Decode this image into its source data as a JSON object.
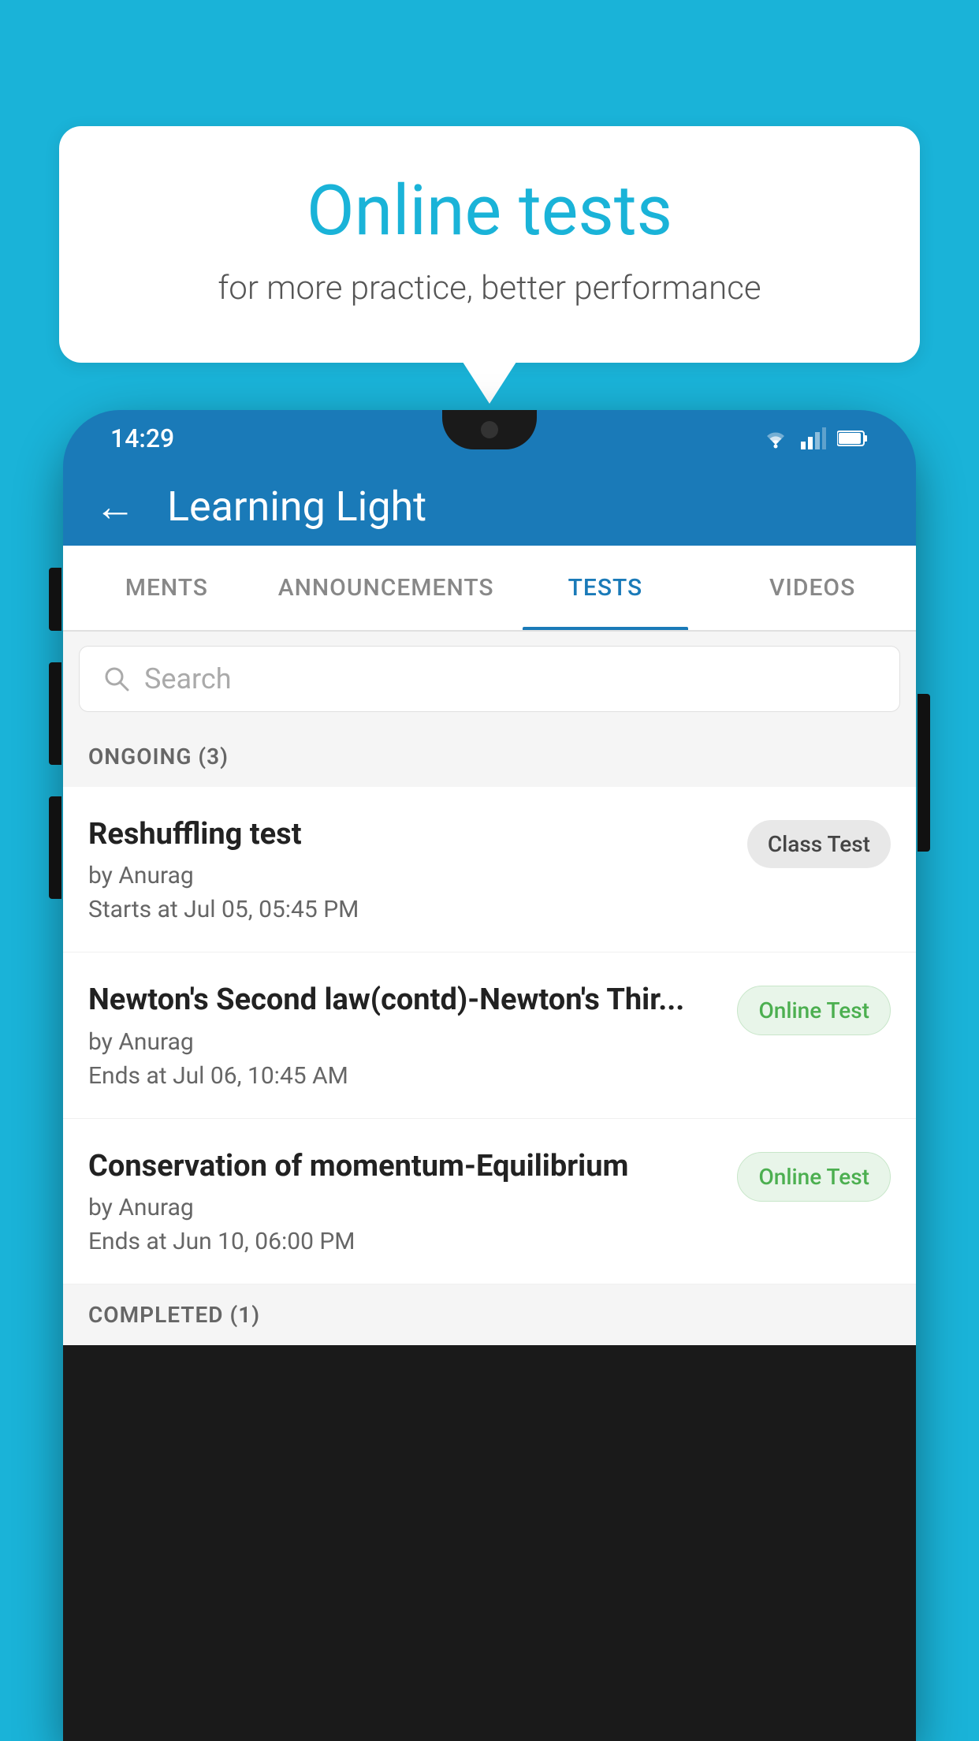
{
  "background_color": "#1ab3d8",
  "speech_bubble": {
    "title": "Online tests",
    "subtitle": "for more practice, better performance"
  },
  "phone": {
    "status_bar": {
      "time": "14:29",
      "icons": [
        "wifi",
        "signal",
        "battery"
      ]
    },
    "app_header": {
      "back_label": "←",
      "title": "Learning Light"
    },
    "tabs": [
      {
        "label": "MENTS",
        "active": false
      },
      {
        "label": "ANNOUNCEMENTS",
        "active": false
      },
      {
        "label": "TESTS",
        "active": true
      },
      {
        "label": "VIDEOS",
        "active": false
      }
    ],
    "search": {
      "placeholder": "Search"
    },
    "ongoing_section": {
      "header": "ONGOING (3)",
      "tests": [
        {
          "name": "Reshuffling test",
          "author": "by Anurag",
          "time_label": "Starts at",
          "time": "Jul 05, 05:45 PM",
          "badge": "Class Test",
          "badge_type": "class"
        },
        {
          "name": "Newton's Second law(contd)-Newton's Thir...",
          "author": "by Anurag",
          "time_label": "Ends at",
          "time": "Jul 06, 10:45 AM",
          "badge": "Online Test",
          "badge_type": "online"
        },
        {
          "name": "Conservation of momentum-Equilibrium",
          "author": "by Anurag",
          "time_label": "Ends at",
          "time": "Jun 10, 06:00 PM",
          "badge": "Online Test",
          "badge_type": "online"
        }
      ]
    },
    "completed_section": {
      "header": "COMPLETED (1)"
    }
  }
}
